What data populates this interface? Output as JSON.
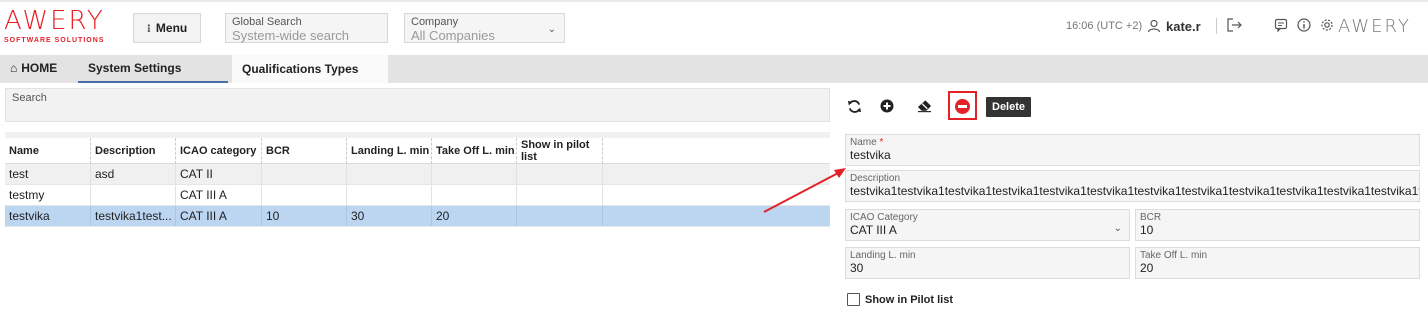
{
  "brand": {
    "logo_main": "AWERY",
    "logo_sub": "SOFTWARE SOLUTIONS",
    "logo_small": "AWERY",
    "color": "#e42127"
  },
  "header": {
    "menu_label": "Menu",
    "global_search": {
      "label": "Global Search",
      "placeholder": "System-wide search"
    },
    "company": {
      "label": "Company",
      "value": "All Companies"
    },
    "time": "16:06 (UTC +2)",
    "user": "kate.r",
    "icons": [
      "user-icon",
      "logout-icon",
      "chat-icon",
      "info-icon",
      "settings-icon"
    ]
  },
  "tabs": [
    {
      "label": "HOME",
      "icon": "home-icon"
    },
    {
      "label": "System Settings"
    },
    {
      "label": "Qualifications Types",
      "active": true
    }
  ],
  "search": {
    "label": "Search"
  },
  "table": {
    "columns": [
      "Name",
      "Description",
      "ICAO category",
      "BCR",
      "Landing L. min",
      "Take Off L. min",
      "Show in pilot list"
    ],
    "rows": [
      {
        "name": "test",
        "description": "asd",
        "icao": "CAT II",
        "bcr": "",
        "landing": "",
        "takeoff": "",
        "show": ""
      },
      {
        "name": "testmy",
        "description": "",
        "icao": "CAT III A",
        "bcr": "",
        "landing": "",
        "takeoff": "",
        "show": ""
      },
      {
        "name": "testvika",
        "description": "testvika1test...",
        "icao": "CAT III A",
        "bcr": "10",
        "landing": "30",
        "takeoff": "20",
        "show": "",
        "selected": true
      }
    ]
  },
  "toolbar": {
    "icons": [
      "refresh-icon",
      "add-icon",
      "eraser-icon",
      "delete-icon"
    ],
    "delete_tooltip": "Delete"
  },
  "form": {
    "name": {
      "label": "Name",
      "required_mark": "*",
      "value": "testvika"
    },
    "description": {
      "label": "Description",
      "value": "testvika1testvika1testvika1testvika1testvika1testvika1testvika1testvika1testvika1testvika1testvika1testvika1testvik"
    },
    "icao": {
      "label": "ICAO Category",
      "value": "CAT III A"
    },
    "bcr": {
      "label": "BCR",
      "value": "10"
    },
    "landing": {
      "label": "Landing L. min",
      "value": "30"
    },
    "takeoff": {
      "label": "Take Off L. min",
      "value": "20"
    },
    "show_in_pilot_list": {
      "label": "Show in Pilot list",
      "checked": false
    }
  }
}
